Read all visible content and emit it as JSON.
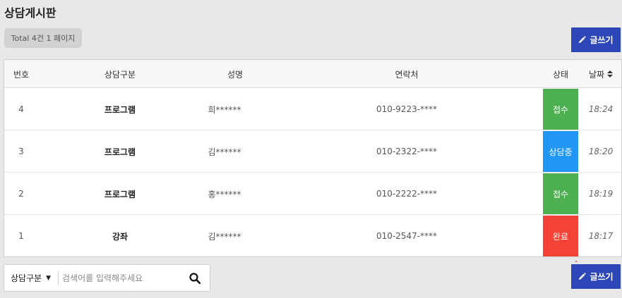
{
  "page": {
    "title": "상담게시판",
    "total_text": "Total 4건 1 페이지"
  },
  "write_button": {
    "label": "글쓰기",
    "icon": "pencil-icon"
  },
  "table": {
    "headers": {
      "no": "번호",
      "category": "상담구분",
      "name": "성명",
      "phone": "연락처",
      "status": "상태",
      "date": "날짜"
    },
    "rows": [
      {
        "no": "4",
        "category": "프로그램",
        "name": "희******",
        "phone": "010-9223-****",
        "status": "접수",
        "status_color": "#4caf50",
        "date": "18:24"
      },
      {
        "no": "3",
        "category": "프로그램",
        "name": "김******",
        "phone": "010-2322-****",
        "status": "상담중",
        "status_color": "#2196f3",
        "date": "18:20"
      },
      {
        "no": "2",
        "category": "프로그램",
        "name": "홍******",
        "phone": "010-2222-****",
        "status": "접수",
        "status_color": "#4caf50",
        "date": "18:19"
      },
      {
        "no": "1",
        "category": "강좌",
        "name": "김******",
        "phone": "010-2547-****",
        "status": "완료",
        "status_color": "#f44336",
        "date": "18:17"
      }
    ]
  },
  "search": {
    "field_selected": "상담구분",
    "placeholder": "검색어를 입력해주세요",
    "value": "",
    "icon": "search-icon"
  },
  "colors": {
    "accent": "#2d47b8",
    "background": "#e8e8e8"
  }
}
